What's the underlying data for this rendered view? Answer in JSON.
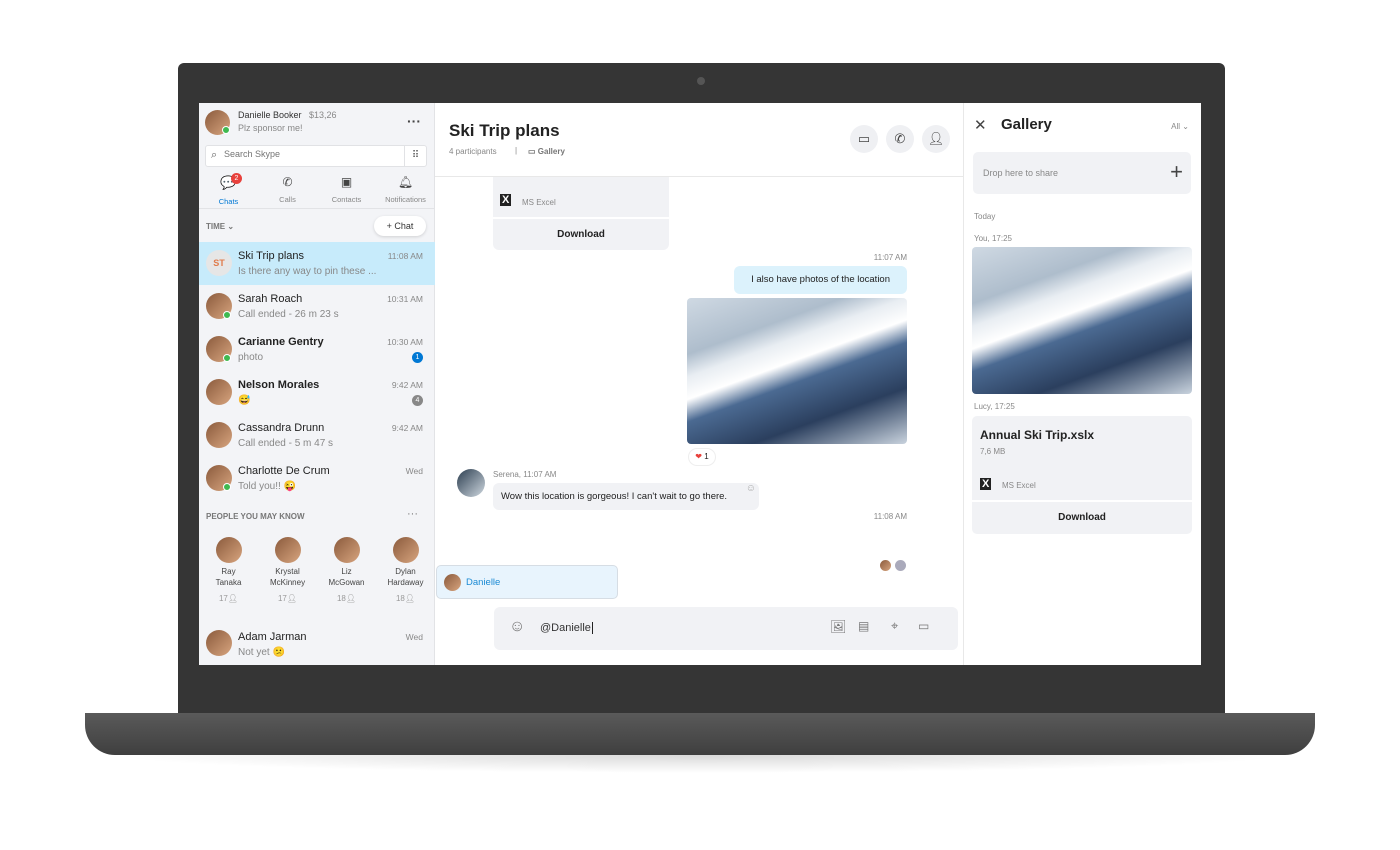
{
  "profile": {
    "name": "Danielle Booker",
    "credit": "$13,26",
    "status": "Plz sponsor me!"
  },
  "search": {
    "placeholder": "Search Skype"
  },
  "nav": [
    {
      "label": "Chats",
      "badge": "2",
      "active": true
    },
    {
      "label": "Calls"
    },
    {
      "label": "Contacts"
    },
    {
      "label": "Notifications"
    }
  ],
  "sort_label": "TIME",
  "new_chat_label": "+ Chat",
  "chats": [
    {
      "initials": "ST",
      "name": "Ski Trip plans",
      "preview": "Is there any way to pin these ...",
      "time": "11:08 AM",
      "selected": true
    },
    {
      "name": "Sarah Roach",
      "preview": "Call ended - 26 m 23 s",
      "time": "10:31 AM",
      "online": true
    },
    {
      "name": "Carianne Gentry",
      "preview": "photo",
      "time": "10:30 AM",
      "badge": "1",
      "bold": true,
      "online": true
    },
    {
      "name": "Nelson Morales",
      "preview": "😅",
      "time": "9:42 AM",
      "badge": "4",
      "bold": true
    },
    {
      "name": "Cassandra Drunn",
      "preview": "Call ended - 5 m 47 s",
      "time": "9:42 AM"
    },
    {
      "name": "Charlotte De Crum",
      "preview": "Told you!! 😜",
      "time": "Wed",
      "online": true
    }
  ],
  "people_header": "PEOPLE YOU MAY KNOW",
  "people": [
    {
      "first": "Ray",
      "last": "Tanaka",
      "mutual": "17"
    },
    {
      "first": "Krystal",
      "last": "McKinney",
      "mutual": "17"
    },
    {
      "first": "Liz",
      "last": "McGowan",
      "mutual": "18"
    },
    {
      "first": "Dylan",
      "last": "Hardaway",
      "mutual": "18"
    }
  ],
  "last_chat": {
    "name": "Adam Jarman",
    "preview": "Not yet 😕",
    "time": "Wed"
  },
  "conversation": {
    "title": "Ski Trip plans",
    "participants": "4 participants",
    "gallery_link": "Gallery",
    "file_type": "MS Excel",
    "download": "Download",
    "msg1_time": "11:07 AM",
    "msg1": "I also have photos of the location",
    "reaction_count": "1",
    "msg2_sender": "Serena, 11:07 AM",
    "msg2": "Wow this location is gorgeous! I can't wait to go there.",
    "msg3_time": "11:08 AM",
    "mention_suggestion": "Danielle",
    "compose_value": "@Danielle"
  },
  "gallery": {
    "title": "Gallery",
    "filter": "All",
    "drop_label": "Drop here to share",
    "section": "Today",
    "item1_meta": "You, 17:25",
    "item2_meta": "Lucy, 17:25",
    "file_name": "Annual Ski Trip.xslx",
    "file_size": "7,6 MB",
    "file_type": "MS Excel",
    "download": "Download"
  },
  "colors": {
    "accent": "#0078d4",
    "selected": "#c7ebfb",
    "badge_red": "#e8413c",
    "online": "#3fb950"
  }
}
